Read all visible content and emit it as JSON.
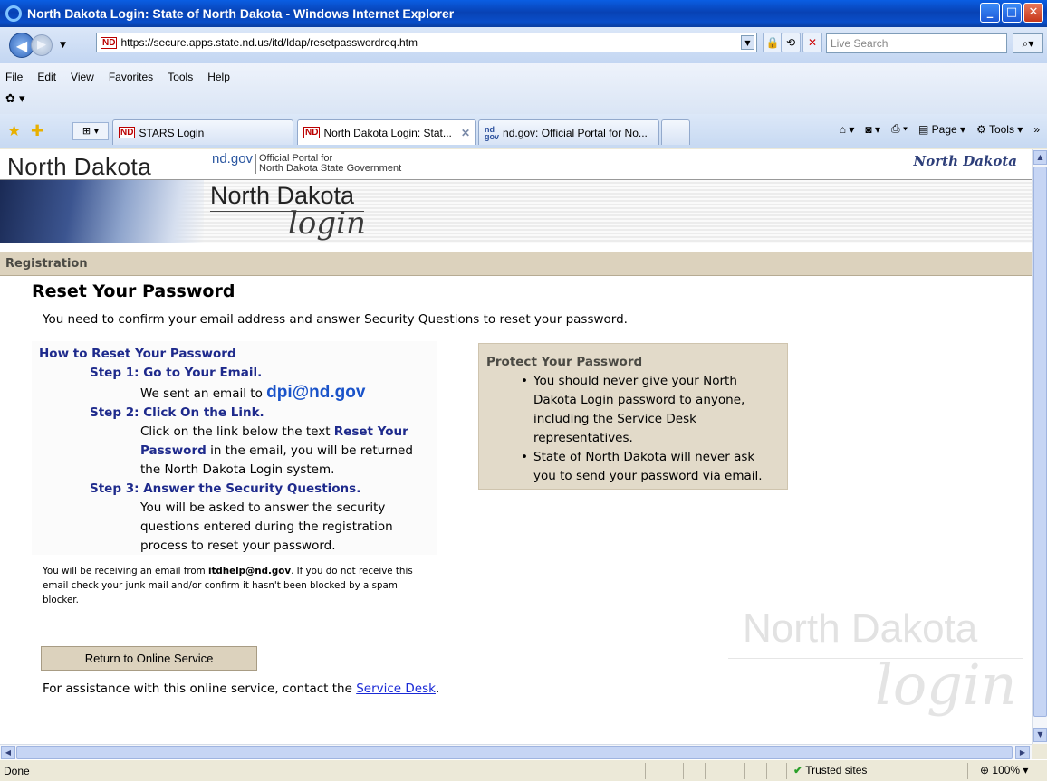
{
  "window": {
    "title": "North Dakota Login: State of North Dakota - Windows Internet Explorer"
  },
  "address_bar": {
    "url": "https://secure.apps.state.nd.us/itd/ldap/resetpasswordreq.htm",
    "search_placeholder": "Live Search"
  },
  "menu": [
    "File",
    "Edit",
    "View",
    "Favorites",
    "Tools",
    "Help"
  ],
  "tabs": [
    {
      "label": "STARS Login",
      "favicon": "ND"
    },
    {
      "label": "North Dakota Login: Stat...",
      "favicon": "ND"
    },
    {
      "label": "nd.gov: Official Portal for No...",
      "favicon": "nd gov"
    }
  ],
  "command_bar": {
    "page": "Page",
    "tools": "Tools"
  },
  "site": {
    "wordmark": "North Dakota",
    "ndgov": "nd.gov",
    "portal_line1": "Official Portal for",
    "portal_line2": "North Dakota State Government",
    "legendary": "North Dakota",
    "banner_title": "North Dakota",
    "banner_login": "login",
    "section": "Registration"
  },
  "content": {
    "title": "Reset Your Password",
    "intro": "You need to confirm your email address and answer Security Questions to reset your password.",
    "howto": {
      "heading": "How to Reset Your Password",
      "step1": "Step 1: Go to Your Email.",
      "step1_text": "We sent an email to",
      "email": "dpi@nd.gov",
      "step2": "Step 2: Click On the Link.",
      "step2_text_a": "Click on the link below the text",
      "step2_emph": "Reset Your Password",
      "step2_text_b": "in the email, you will be returned the North Dakota Login system.",
      "step3": "Step 3: Answer the Security Questions.",
      "step3_text": "You will be asked to answer the security questions entered during the registration process to reset your password."
    },
    "notice_a": "You will be receiving an email from",
    "notice_email": "itdhelp@nd.gov",
    "notice_b": ". If you do not receive this email check your junk mail and/or confirm it hasn't been blocked by a spam blocker.",
    "protect": {
      "heading": "Protect Your Password",
      "items": [
        "You should never give your North Dakota Login password to anyone, including the Service Desk representatives.",
        "State of North Dakota will never ask you to send your password via email."
      ]
    },
    "return_button": "Return to Online Service",
    "assist_text": "For assistance with this online service, contact the",
    "assist_link": "Service Desk",
    "assist_end": "."
  },
  "watermark": {
    "line1": "North Dakota",
    "line2": "login"
  },
  "status": {
    "text": "Done",
    "zone": "Trusted sites",
    "zoom": "100%"
  }
}
